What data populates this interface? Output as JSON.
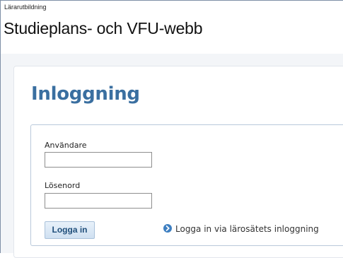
{
  "header": {
    "subtitle": "Lärarutbildning",
    "title": "Studieplans- och VFU-webb"
  },
  "login": {
    "heading": "Inloggning",
    "username_label": "Användare",
    "username_value": "",
    "password_label": "Lösenord",
    "password_value": "",
    "submit_label": "Logga in",
    "alt_login_label": "Logga in via lärosätets inloggning",
    "alt_login_icon": "chevron-right-circle-icon"
  },
  "colors": {
    "heading": "#3a6fa0",
    "accent": "#3e7fc1"
  }
}
